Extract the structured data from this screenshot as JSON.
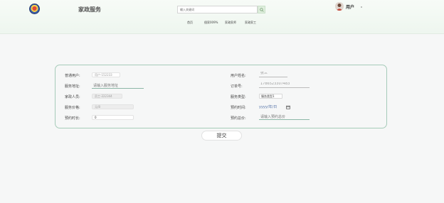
{
  "header": {
    "site_title": "家政服务",
    "search_placeholder": "输入关键词",
    "user_name": "用户"
  },
  "nav": [
    {
      "label": "首页"
    },
    {
      "label": "個家009%"
    },
    {
      "label": "家政家师"
    },
    {
      "label": "家政家工"
    }
  ],
  "form": {
    "left": [
      {
        "label": "普通用户:",
        "value": "用户-152233"
      },
      {
        "label": "服务地址:",
        "placeholder": "请输入服务地址"
      },
      {
        "label": "家政人员:",
        "value": "员工-222344"
      },
      {
        "label": "服务价格:",
        "value": "元/8"
      },
      {
        "label": "预约时长:",
        "value": "0"
      }
    ],
    "right": [
      {
        "label": "用户姓名:",
        "value": "张三"
      },
      {
        "label": "订单号:",
        "value": "1786523307483"
      },
      {
        "label": "服务类型:",
        "value": "服务类型1"
      },
      {
        "label": "预约时间:",
        "value": "yyyy/年/日"
      },
      {
        "label": "预约总价:",
        "placeholder": "请输入预约总价"
      }
    ],
    "submit_label": "提交"
  }
}
